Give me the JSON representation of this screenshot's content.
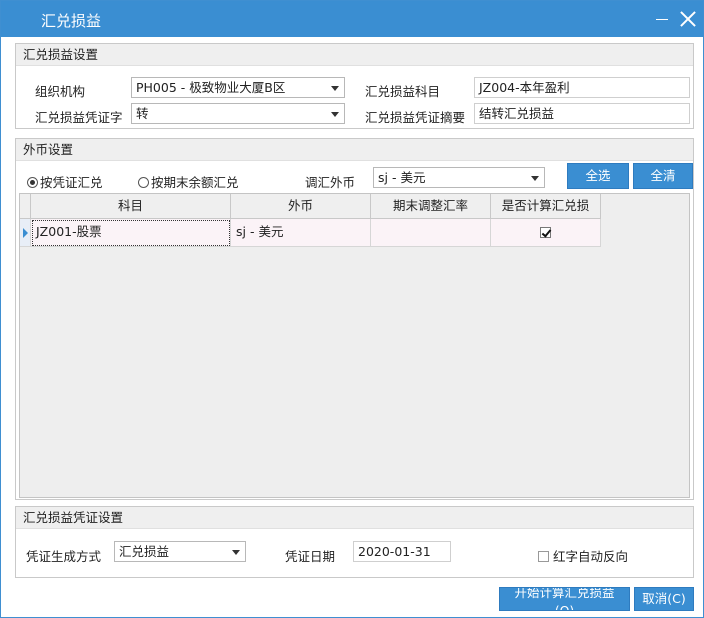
{
  "window": {
    "title": "汇兑损益"
  },
  "settings": {
    "section_title": "汇兑损益设置",
    "org_label": "组织机构",
    "org_value": "PH005 - 极致物业大厦B区",
    "voucher_word_label": "汇兑损益凭证字",
    "voucher_word_value": "转",
    "account_label": "汇兑损益科目",
    "account_value": "JZ004-本年盈利",
    "summary_label": "汇兑损益凭证摘要",
    "summary_value": "结转汇兑损益"
  },
  "currency": {
    "section_title": "外币设置",
    "radio_by_voucher": "按凭证汇兑",
    "radio_by_balance": "按期末余额汇兑",
    "selected_mode": "by_voucher",
    "adjust_label": "调汇外币",
    "adjust_value": "sj - 美元",
    "select_all_label": "全选",
    "clear_all_label": "全清",
    "table": {
      "columns": [
        "科目",
        "外币",
        "期末调整汇率",
        "是否计算汇兑损"
      ],
      "rows": [
        {
          "account": "JZ001-股票",
          "currency": "sj - 美元",
          "rate": "",
          "calculate": true
        }
      ]
    }
  },
  "voucher": {
    "section_title": "汇兑损益凭证设置",
    "method_label": "凭证生成方式",
    "method_value": "汇兑损益",
    "date_label": "凭证日期",
    "date_value": "2020-01-31",
    "red_reverse_label": "红字自动反向",
    "red_reverse_checked": false
  },
  "footer": {
    "start_label": "开始计算汇兑损益(O)",
    "cancel_label": "取消(C)"
  }
}
